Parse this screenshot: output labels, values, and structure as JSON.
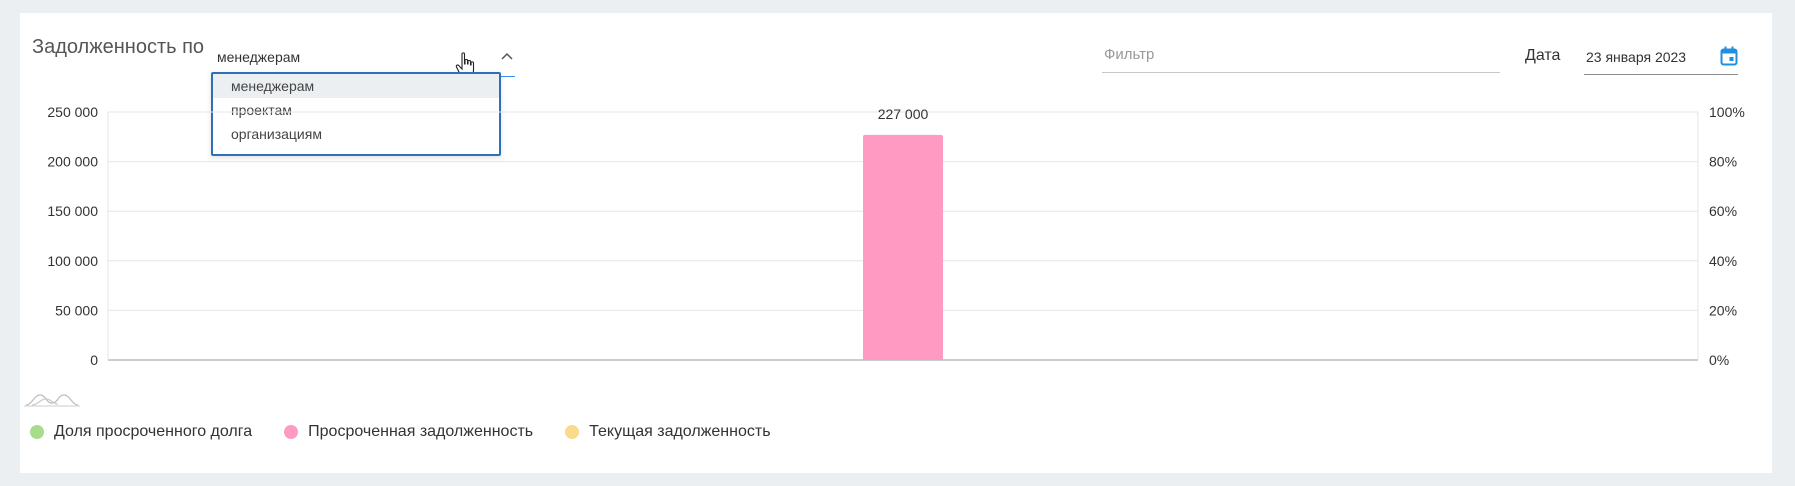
{
  "header": {
    "title": "Задолженность по",
    "group_by": {
      "selected": "менеджерам",
      "options": [
        "менеджерам",
        "проектам",
        "организациям"
      ]
    },
    "filter": {
      "placeholder": "Фильтр",
      "value": ""
    },
    "date": {
      "label": "Дата",
      "value": "23 января 2023"
    }
  },
  "colors": {
    "accent": "#3f8ef5",
    "calendar": "#1f8fe0",
    "overdue_share": "#a7dc8a",
    "overdue_debt": "#ff9bc3",
    "current_debt": "#fbd98c"
  },
  "legend": [
    {
      "label": "Доля просроченного долга",
      "color": "#a7dc8a"
    },
    {
      "label": "Просроченная задолженность",
      "color": "#ff9bc3"
    },
    {
      "label": "Текущая задолженность",
      "color": "#fbd98c"
    }
  ],
  "chart_data": {
    "type": "bar",
    "categories": [
      ""
    ],
    "series": [
      {
        "name": "Просроченная задолженность",
        "values": [
          227000
        ],
        "color": "#ff9bc3",
        "axis": "left"
      }
    ],
    "data_labels": [
      "227 000"
    ],
    "y_left": {
      "ylim": [
        0,
        250000
      ],
      "ticks": [
        "0",
        "50 000",
        "100 000",
        "150 000",
        "200 000",
        "250 000"
      ]
    },
    "y_right": {
      "ylim": [
        0,
        100
      ],
      "ticks": [
        "0%",
        "20%",
        "40%",
        "60%",
        "80%",
        "100%"
      ]
    },
    "grid": true,
    "legend_position": "bottom-left"
  }
}
